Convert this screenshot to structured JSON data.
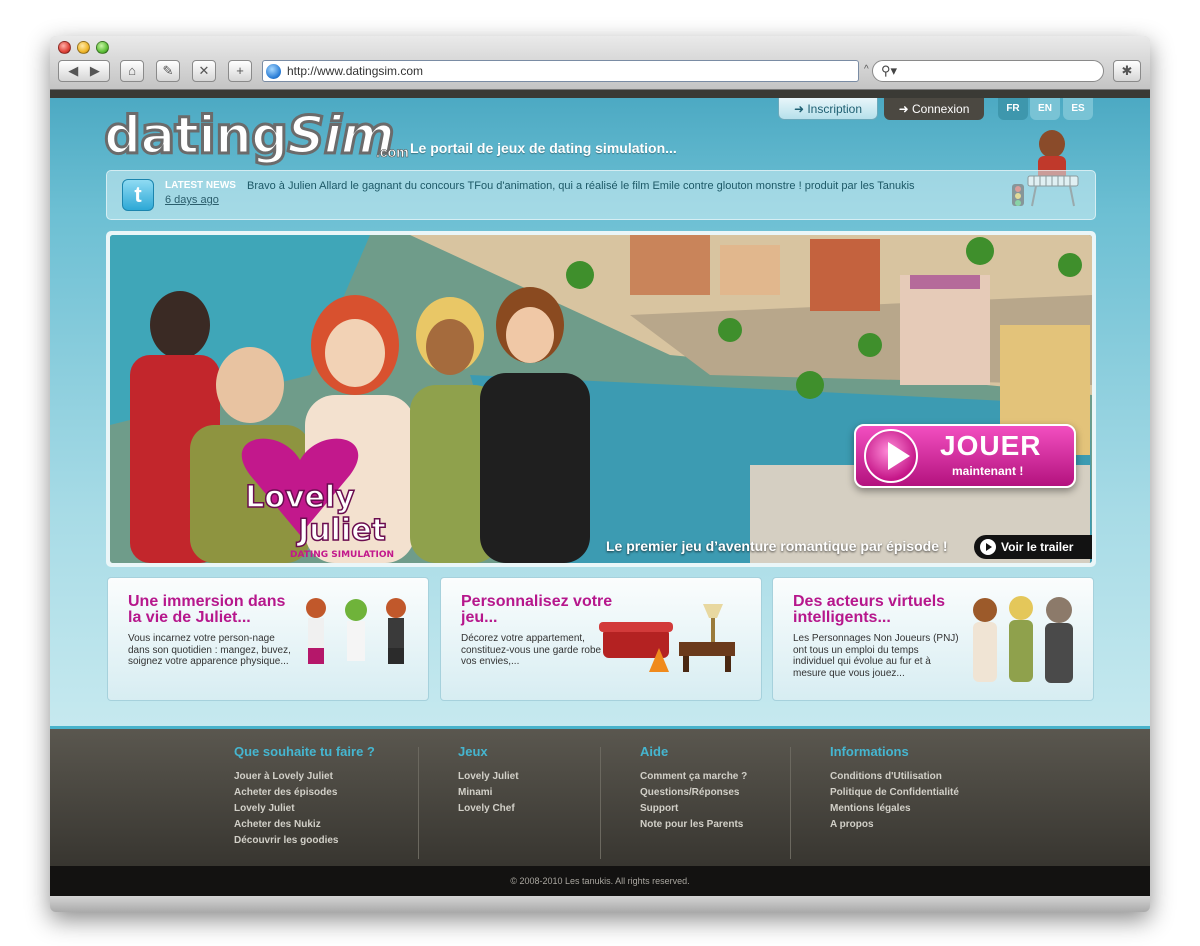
{
  "browser": {
    "url": "http://www.datingsim.com",
    "icons": [
      "back-icon",
      "forward-icon",
      "home-icon",
      "edit-icon",
      "stop-icon",
      "add-icon",
      "search-icon",
      "bug-icon"
    ]
  },
  "header": {
    "inscription": "➜ Inscription",
    "connexion": "➜ Connexion",
    "languages": [
      "FR",
      "EN",
      "ES"
    ],
    "logo_main": "dating",
    "logo_sim": "Sim",
    "logo_com": ".com",
    "tagline": "Le portail de jeux de dating simulation..."
  },
  "news": {
    "label": "LATEST NEWS",
    "text": "Bravo à Julien Allard le gagnant du concours TFou d'animation, qui a réalisé le film Emile contre glouton monstre ! produit par les Tanukis",
    "date": "6 days ago"
  },
  "hero": {
    "game_logo_line1": "Lovely",
    "game_logo_line2": "Juliet",
    "game_logo_sub": "DATING SIMULATION",
    "jouer": "JOUER",
    "jouer_sub": "maintenant !",
    "caption": "Le premier jeu d’aventure romantique par épisode !",
    "trailer": "Voir le trailer"
  },
  "features": [
    {
      "title": "Une immersion dans la vie de Juliet...",
      "text": "Vous incarnez votre person-nage dans son quotidien : mangez, buvez, soignez votre apparence physique..."
    },
    {
      "title": "Personnalisez votre jeu...",
      "text": "Décorez votre appartement, constituez-vous une garde robe selon vos envies,..."
    },
    {
      "title": "Des acteurs virtuels intelligents...",
      "text": "Les Personnages Non Joueurs (PNJ) ont tous un emploi du temps individuel qui évolue au fur et à mesure que vous jouez..."
    }
  ],
  "footer": {
    "columns": [
      {
        "title": "Que souhaite tu faire ?",
        "links": [
          "Jouer à Lovely Juliet",
          "Acheter des épisodes",
          "Lovely  Juliet",
          "Acheter des Nukiz",
          "Découvrir les goodies"
        ]
      },
      {
        "title": "Jeux",
        "links": [
          "Lovely Juliet",
          "Minami",
          "Lovely Chef"
        ]
      },
      {
        "title": "Aide",
        "links": [
          "Comment ça marche ?",
          "Questions/Réponses",
          "Support",
          "Note pour les Parents"
        ]
      },
      {
        "title": "Informations",
        "links": [
          "Conditions d'Utilisation",
          "Politique de Confidentialité",
          "Mentions légales",
          "A propos"
        ]
      }
    ],
    "copyright": "© 2008-2010 Les tanukis. All rights reserved."
  },
  "colors": {
    "accent_pink": "#b6178c",
    "accent_blue": "#45b6d0",
    "site_background": "#6cbfd3",
    "footer_background": "#3f3c36"
  }
}
